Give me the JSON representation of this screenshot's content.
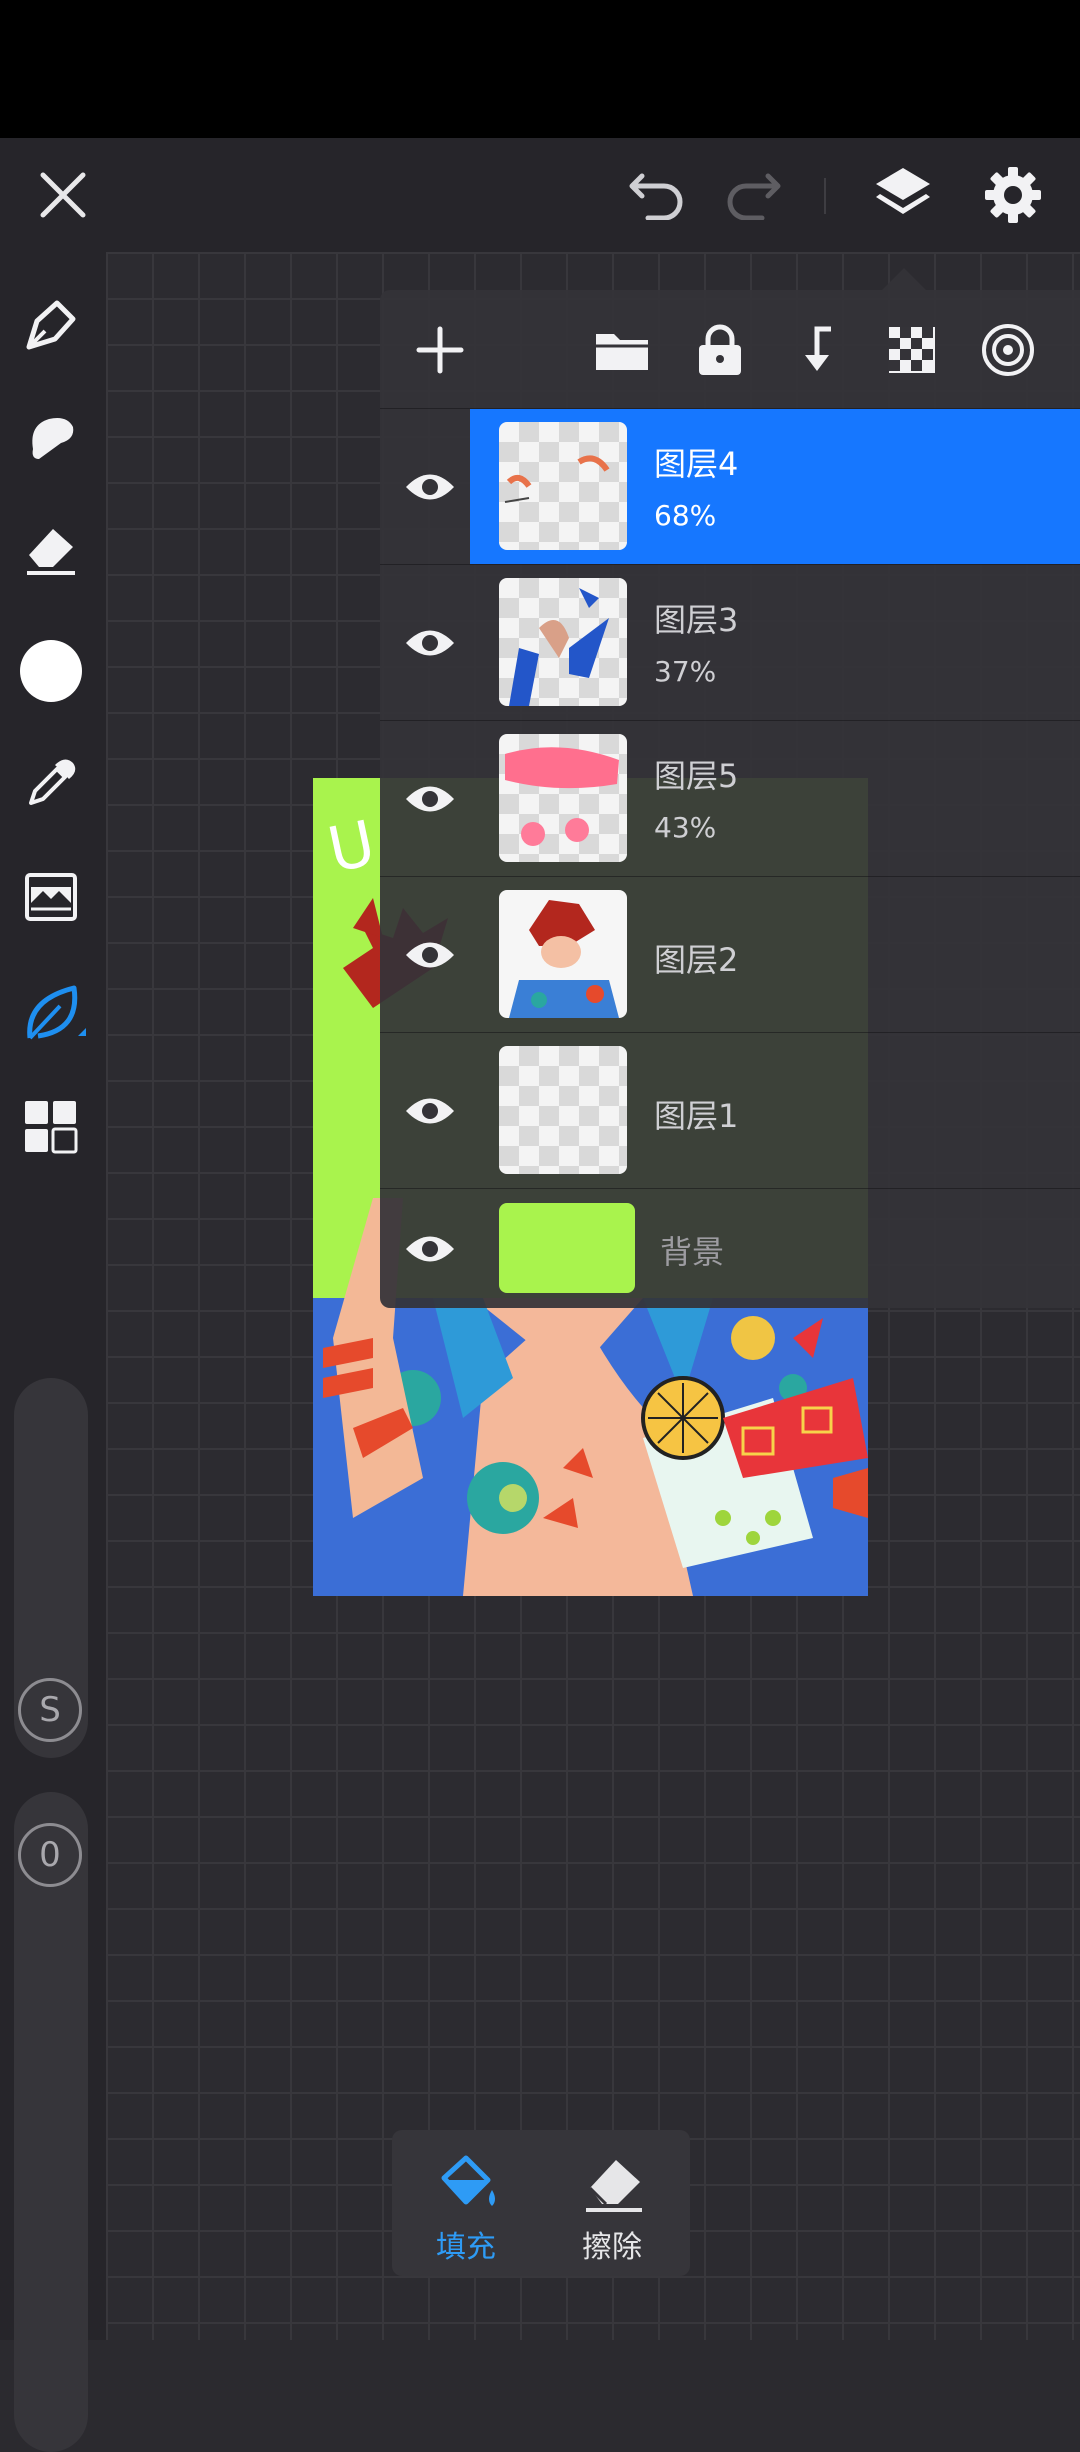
{
  "toolbar_top": {
    "close_icon": "close-icon",
    "undo_icon": "undo-icon",
    "redo_icon": "redo-icon",
    "layers_icon": "layers-icon",
    "settings_icon": "gear-icon"
  },
  "left_toolbar": {
    "tools": [
      "brush-pen-icon",
      "smudge-icon",
      "eraser-icon",
      "color-swatch",
      "eyedropper-icon",
      "adjustment-icon",
      "leaf-stroke-icon",
      "grid-icon"
    ],
    "size_badge": "S",
    "opacity_badge": "0",
    "current_color": "#ffffff",
    "accent": "#1e8ff0"
  },
  "layers_panel": {
    "toolbar_icons": [
      "add-layer-icon",
      "folder-icon",
      "lock-icon",
      "merge-down-icon",
      "checkerboard-icon",
      "blend-mode-icon"
    ],
    "layers": [
      {
        "name": "图层4",
        "opacity": "68%",
        "selected": true
      },
      {
        "name": "图层3",
        "opacity": "37%",
        "selected": false
      },
      {
        "name": "图层5",
        "opacity": "43%",
        "selected": false
      },
      {
        "name": "图层2",
        "opacity": "",
        "selected": false
      },
      {
        "name": "图层1",
        "opacity": "",
        "selected": false
      }
    ],
    "background": {
      "name": "背景",
      "color": "#a9f34d"
    }
  },
  "bottom_bar": {
    "fill_label": "填充",
    "erase_label": "擦除",
    "fill_color": "#2e9bf5"
  }
}
